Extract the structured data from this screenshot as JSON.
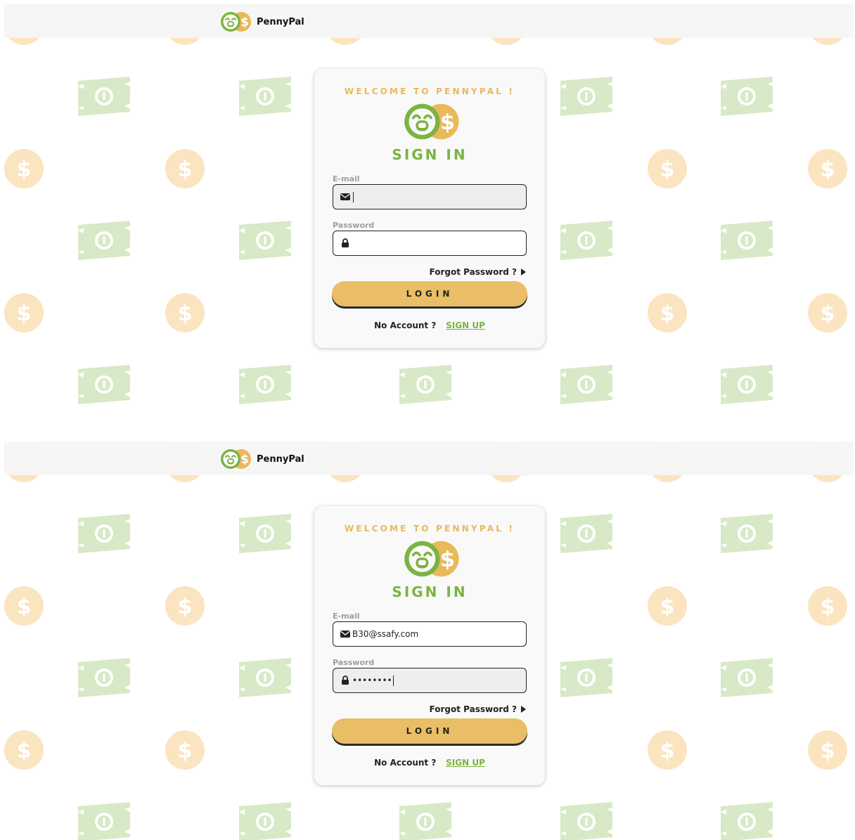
{
  "app": {
    "brand": "PennyPal",
    "logo_icon": "pennypal-logo-icon"
  },
  "login": {
    "welcome": "WELCOME TO PENNYPAL !",
    "title": "SIGN IN",
    "email_label": "E-mail",
    "password_label": "Password",
    "forgot": "Forgot Password ?",
    "login_button": "LOGIN",
    "no_account": "No Account ?",
    "signup": "SIGN UP"
  },
  "states": [
    {
      "email_value": "",
      "password_value": "",
      "focused": "email"
    },
    {
      "email_value": "B30@ssafy.com",
      "password_value": "••••••••",
      "focused": "password"
    }
  ],
  "colors": {
    "green": "#7cb342",
    "gold": "#e8b95a",
    "bill_green": "#d7e9c6",
    "coin_gold": "#fbe4c0"
  }
}
